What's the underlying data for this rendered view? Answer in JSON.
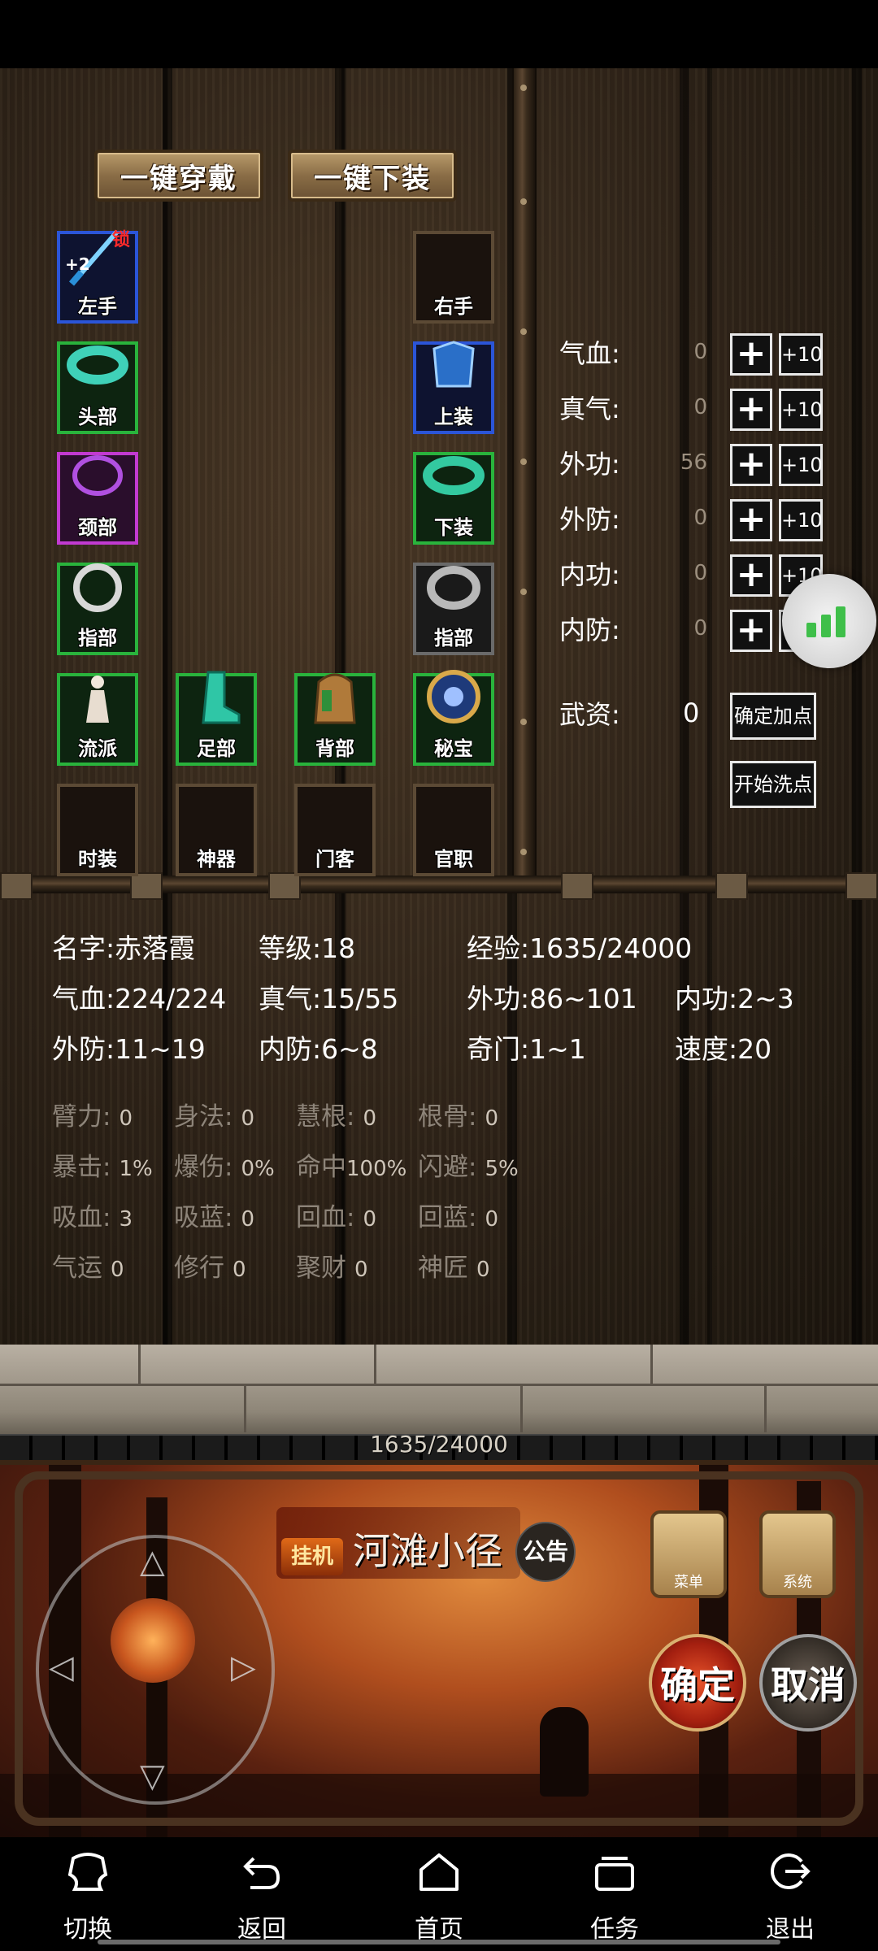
{
  "top_buttons": {
    "equip_all": "一键穿戴",
    "unequip_all": "一键下装"
  },
  "equipment": {
    "left_hand": {
      "label": "左手",
      "enhance": "+2",
      "lock": "锁"
    },
    "right_hand": {
      "label": "右手"
    },
    "head": {
      "label": "头部"
    },
    "upper": {
      "label": "上装"
    },
    "neck": {
      "label": "颈部"
    },
    "lower": {
      "label": "下装"
    },
    "ring_left": {
      "label": "指部"
    },
    "ring_right": {
      "label": "指部"
    },
    "school": {
      "label": "流派"
    },
    "foot": {
      "label": "足部"
    },
    "back": {
      "label": "背部"
    },
    "treasure": {
      "label": "秘宝"
    },
    "fashion": {
      "label": "时装"
    },
    "artifact": {
      "label": "神器"
    },
    "retainer": {
      "label": "门客"
    },
    "official": {
      "label": "官职"
    }
  },
  "attributes": [
    {
      "label": "气血:",
      "value": "0",
      "plus10": "+10"
    },
    {
      "label": "真气:",
      "value": "0",
      "plus10": "+10"
    },
    {
      "label": "外功:",
      "value": "56",
      "plus10": "+10"
    },
    {
      "label": "外防:",
      "value": "0",
      "plus10": "+10"
    },
    {
      "label": "内功:",
      "value": "0",
      "plus10": "+10"
    },
    {
      "label": "内防:",
      "value": "0",
      "plus10": "+10"
    }
  ],
  "wuzi": {
    "label": "武资:",
    "value": "0"
  },
  "confirm_points_label": "确定加点",
  "reset_points_label": "开始洗点",
  "character": {
    "name": "名字:赤落霞",
    "level": "等级:18",
    "exp": "经验:1635/24000",
    "hp": "气血:224/224",
    "qi": "真气:15/55",
    "outer_attack": "外功:86~101",
    "inner_attack": "内功:2~3",
    "outer_def": "外防:11~19",
    "inner_def": "内防:6~8",
    "qimen": "奇门:1~1",
    "speed": "速度:20"
  },
  "secondary_stats": [
    [
      {
        "label": "臂力:",
        "value": "0"
      },
      {
        "label": "身法:",
        "value": "0"
      },
      {
        "label": "慧根:",
        "value": "0"
      },
      {
        "label": "根骨:",
        "value": "0"
      }
    ],
    [
      {
        "label": "暴击:",
        "value": "1%"
      },
      {
        "label": "爆伤:",
        "value": "0%"
      },
      {
        "label": "命中",
        "value": "100%"
      },
      {
        "label": "闪避:",
        "value": "5%"
      }
    ],
    [
      {
        "label": "吸血:",
        "value": "3"
      },
      {
        "label": "吸蓝:",
        "value": "0"
      },
      {
        "label": "回血:",
        "value": "0"
      },
      {
        "label": "回蓝:",
        "value": "0"
      }
    ],
    [
      {
        "label": "气运",
        "value": "0"
      },
      {
        "label": "修行",
        "value": "0"
      },
      {
        "label": "聚财",
        "value": "0"
      },
      {
        "label": "神匠",
        "value": "0"
      }
    ]
  ],
  "exp_bar": {
    "text": "1635/24000",
    "progress": 0.068
  },
  "scene": {
    "location": "河滩小径",
    "idle_badge": "挂机",
    "notice": "公告",
    "menu_btn": "菜单",
    "system_btn": "系统",
    "confirm": "确定",
    "cancel": "取消"
  },
  "nav": [
    {
      "label": "切换",
      "icon": "switch-icon"
    },
    {
      "label": "返回",
      "icon": "back-icon"
    },
    {
      "label": "首页",
      "icon": "home-icon"
    },
    {
      "label": "任务",
      "icon": "tasks-icon"
    },
    {
      "label": "退出",
      "icon": "exit-icon"
    }
  ],
  "colors": {
    "slot_blue": "#2b55d8",
    "slot_green": "#29b33c",
    "slot_purple": "#c23ad1",
    "float_green": "#3fbf4a"
  }
}
